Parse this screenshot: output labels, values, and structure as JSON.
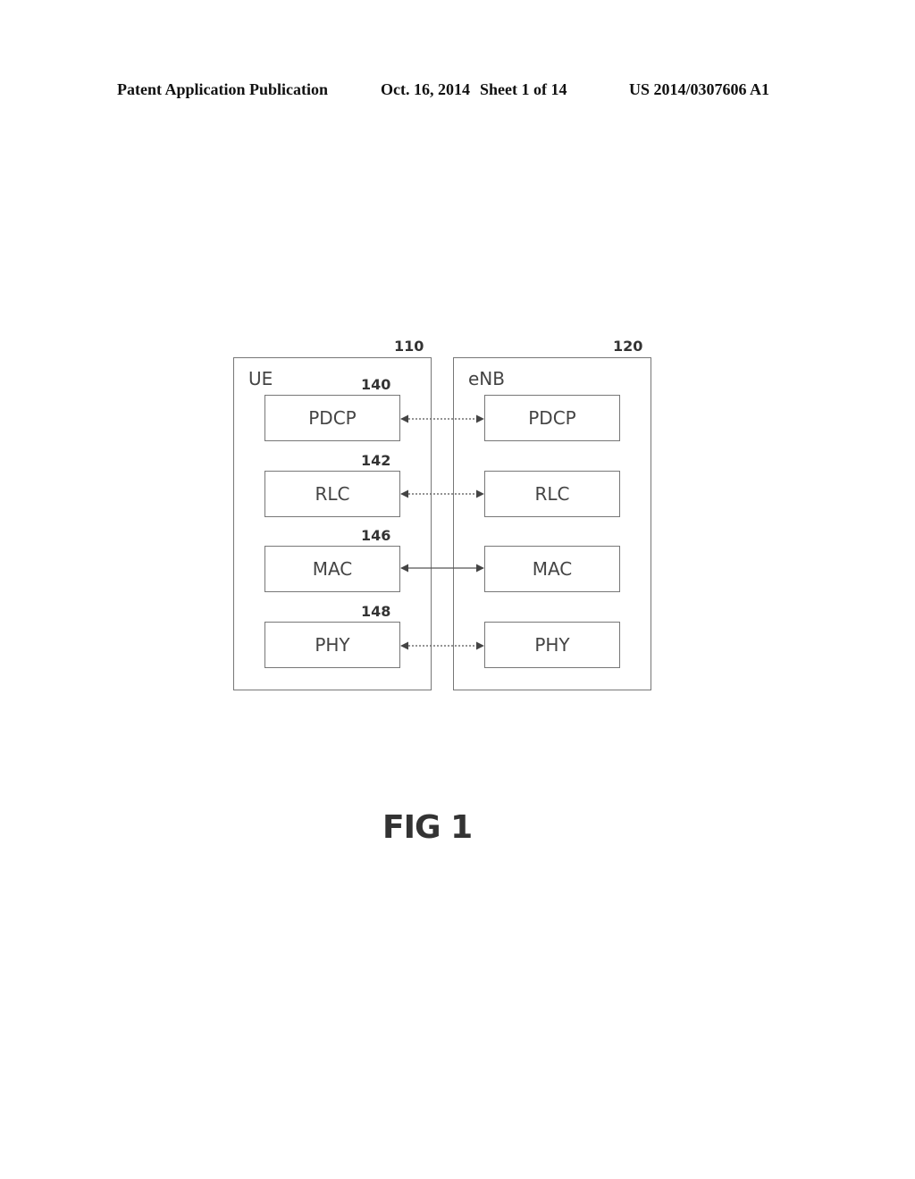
{
  "header": {
    "publication": "Patent Application Publication",
    "date": "Oct. 16, 2014",
    "sheet": "Sheet 1 of 14",
    "number": "US 2014/0307606 A1"
  },
  "diagram": {
    "left_entity": {
      "label": "UE",
      "ref": "110"
    },
    "right_entity": {
      "label": "eNB",
      "ref": "120"
    },
    "layers": [
      {
        "name": "PDCP",
        "ref": "140",
        "link": "dashed"
      },
      {
        "name": "RLC",
        "ref": "142",
        "link": "dashed"
      },
      {
        "name": "MAC",
        "ref": "146",
        "link": "solid"
      },
      {
        "name": "PHY",
        "ref": "148",
        "link": "dashed"
      }
    ]
  },
  "figure": {
    "caption": "FIG 1"
  }
}
